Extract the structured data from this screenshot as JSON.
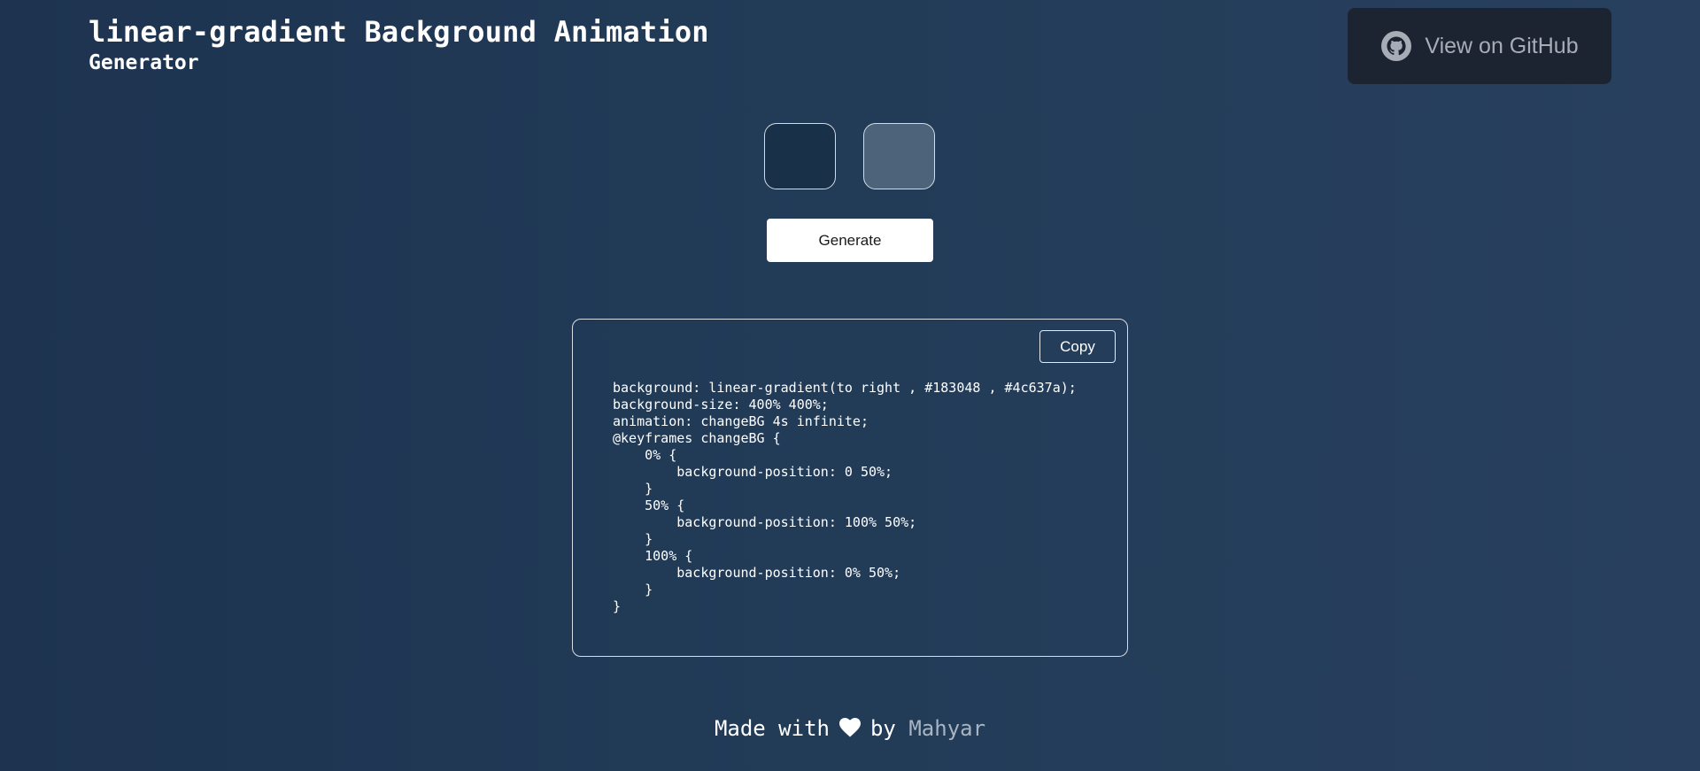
{
  "header": {
    "title": "linear-gradient Background Animation",
    "subtitle": "Generator"
  },
  "github_button": {
    "label": "View on GitHub",
    "icon": "github-icon"
  },
  "color_pickers": [
    {
      "color": "#183048"
    },
    {
      "color": "#4c637a"
    }
  ],
  "generate_button": {
    "label": "Generate"
  },
  "code_output": {
    "copy_label": "Copy",
    "code": "background: linear-gradient(to right , #183048 , #4c637a);\nbackground-size: 400% 400%;\nanimation: changeBG 4s infinite;\n@keyframes changeBG {\n    0% {\n        background-position: 0 50%;\n    }\n    50% {\n        background-position: 100% 50%;\n    }\n    100% {\n        background-position: 0% 50%;\n    }\n}"
  },
  "footer": {
    "made_with": "Made with",
    "heart_icon": "heart-icon",
    "by": "by",
    "author": "Mahyar"
  }
}
